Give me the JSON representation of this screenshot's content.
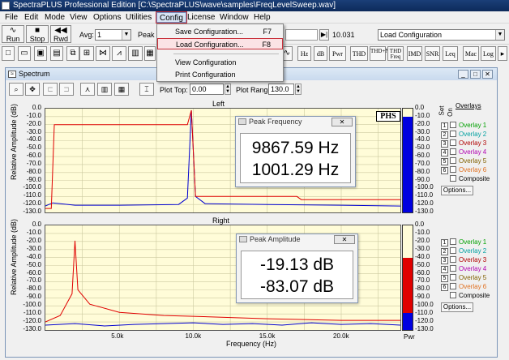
{
  "title": "SpectraPLUS Professional Edition [C:\\SpectraPLUS\\wave\\samples\\FreqLevelSweep.wav]",
  "menu": [
    "File",
    "Edit",
    "Mode",
    "View",
    "Options",
    "Utilities",
    "Config",
    "License",
    "Window",
    "Help"
  ],
  "toolbar": {
    "run_label": "Run",
    "stop_label": "Stop",
    "rwd_label": "Rwd",
    "avg_label": "Avg:",
    "avg_value": "1",
    "peak_label": "Peak",
    "time_value": "10.031",
    "config_select_value": "Load Configuration"
  },
  "config_menu": {
    "save": "Save Configuration...",
    "save_shortcut": "F7",
    "load": "Load Configuration...",
    "load_shortcut": "F8",
    "view": "View Configuration",
    "print": "Print Configuration"
  },
  "toolbar2_right": [
    "Hz",
    "dB",
    "Pwr",
    "THD",
    "THD+N",
    "THD Freq",
    "IMD",
    "SNR",
    "Leq",
    "Mac",
    "Log"
  ],
  "spectrum": {
    "window_title": "Spectrum",
    "plot_top_label": "Plot Top:",
    "plot_top_value": "0.00",
    "plot_range_label": "Plot Range:",
    "plot_range_value": "130.0",
    "left_label": "Left",
    "right_label": "Right",
    "y_axis_label": "Relative Amplitude (dB)",
    "x_axis_label": "Frequency (Hz)",
    "logo": "PHS",
    "y_ticks": [
      "0.0",
      "-10.0",
      "-20.0",
      "-30.0",
      "-40.0",
      "-50.0",
      "-60.0",
      "-70.0",
      "-80.0",
      "-90.0",
      "-100.0",
      "-110.0",
      "-120.0",
      "-130.0"
    ],
    "x_ticks": [
      "5.0k",
      "10.0k",
      "15.0k",
      "20.0k"
    ],
    "colorbar_ticks": [
      "0.0",
      "-10.0",
      "-20.0",
      "-30.0",
      "-40.0",
      "-50.0",
      "-60.0",
      "-70.0",
      "-80.0",
      "-90.0",
      "-100.0",
      "-110.0",
      "-120.0",
      "-130.0"
    ],
    "colorbar_label": "Pwr",
    "overlays_title": "Overlays",
    "set_label": "Set",
    "on_label": "On",
    "overlays": [
      {
        "label": "Overlay 1",
        "color": "#00a000"
      },
      {
        "label": "Overlay 2",
        "color": "#00a0a0"
      },
      {
        "label": "Overlay 3",
        "color": "#b00000"
      },
      {
        "label": "Overlay 4",
        "color": "#b000b0"
      },
      {
        "label": "Overlay 5",
        "color": "#806000"
      },
      {
        "label": "Overlay 6",
        "color": "#e07020"
      }
    ],
    "composite_label": "Composite",
    "options_label": "Options..."
  },
  "peak_frequency": {
    "title": "Peak Frequency",
    "line1": "9867.59 Hz",
    "line2": "1001.29 Hz"
  },
  "peak_amplitude": {
    "title": "Peak Amplitude",
    "line1": "-19.13 dB",
    "line2": "-83.07 dB"
  },
  "colors": {
    "trace_blue": "#0000d0",
    "trace_red": "#e00000",
    "grid": "#ccc9a0",
    "bar_blue": "#0000e0",
    "bar_red": "#e00000"
  },
  "chart_data": [
    {
      "type": "line",
      "title": "Left",
      "xlabel": "Frequency (Hz)",
      "ylabel": "Relative Amplitude (dB)",
      "xlim": [
        0,
        24000
      ],
      "ylim": [
        -130,
        0
      ],
      "series": [
        {
          "color": "#0000d0",
          "x": [
            0,
            500,
            2000,
            5000,
            9000,
            9600,
            9870,
            10150,
            10800,
            15000,
            20000,
            24000
          ],
          "y": [
            -122,
            -118,
            -121,
            -121,
            -120,
            -112,
            -2,
            -110,
            -119,
            -120,
            -121,
            -122
          ]
        },
        {
          "color": "#e00000",
          "x": [
            0,
            400,
            600,
            9600,
            9870,
            10150,
            11000,
            17000,
            17300,
            24000
          ],
          "y": [
            -125,
            -125,
            -20,
            -20,
            -2,
            -110,
            -110,
            -110,
            -114,
            -114
          ]
        }
      ]
    },
    {
      "type": "line",
      "title": "Right",
      "xlabel": "Frequency (Hz)",
      "ylabel": "Relative Amplitude (dB)",
      "xlim": [
        0,
        24000
      ],
      "ylim": [
        -130,
        0
      ],
      "series": [
        {
          "color": "#e00000",
          "x": [
            0,
            1000,
            1800,
            2000,
            2200,
            3000,
            5000,
            8000,
            10000,
            15000,
            20000,
            24000
          ],
          "y": [
            -120,
            -112,
            -85,
            -19,
            -80,
            -98,
            -108,
            -112,
            -113,
            -116,
            -118,
            -118
          ]
        },
        {
          "color": "#0000d0",
          "x": [
            0,
            2000,
            4000,
            6000,
            8000,
            10000,
            12000,
            14000,
            16000,
            18000,
            20000,
            22000,
            24000
          ],
          "y": [
            -124,
            -122,
            -125,
            -123,
            -122,
            -121,
            -123,
            -122,
            -124,
            -121,
            -123,
            -122,
            -124
          ]
        }
      ]
    }
  ]
}
